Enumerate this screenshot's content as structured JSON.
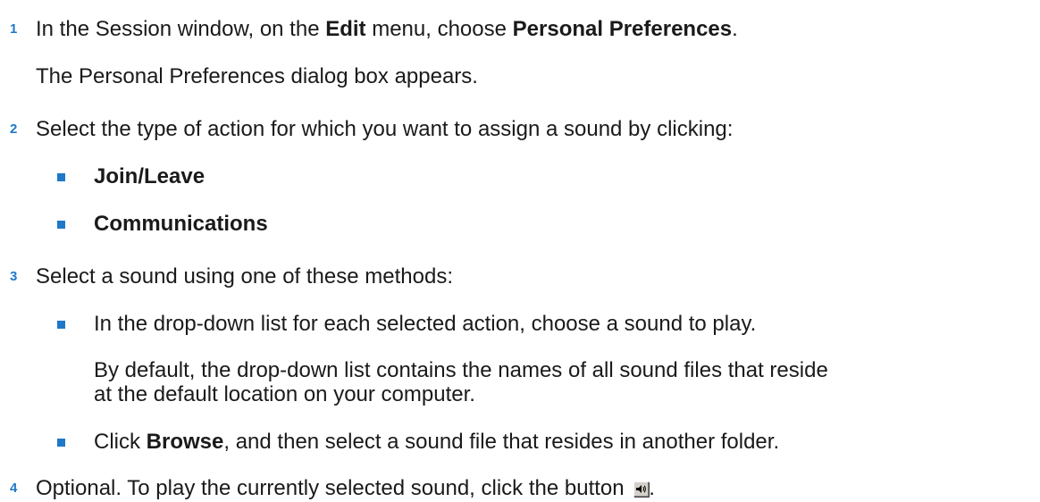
{
  "steps": [
    {
      "number": "1",
      "text_a": "In the Session window, on the ",
      "bold_a": "Edit",
      "text_b": " menu, choose ",
      "bold_b": "Personal Preferences",
      "text_c": ".",
      "note": "The Personal Preferences dialog box appears."
    },
    {
      "number": "2",
      "text": "Select the type of action for which you want to assign a sound by clicking:",
      "options": [
        "Join/Leave",
        "Communications"
      ]
    },
    {
      "number": "3",
      "text": "Select a sound using one of these methods:",
      "method1": "In the drop-down list for each selected action, choose a sound to play.",
      "method1_note_line1": "By default, the drop-down list contains the names of all sound files that reside",
      "method1_note_line2": "at the default location on your computer.",
      "method2_prefix": "Click ",
      "method2_bold": "Browse",
      "method2_suffix": ", and then select a sound file that resides in another folder."
    },
    {
      "number": "4",
      "text": "Optional. To play the currently selected sound, click the button ",
      "end": ".",
      "icon": "speaker-icon"
    }
  ],
  "colors": {
    "accent": "#1f78c8",
    "text": "#1a1a1a"
  }
}
